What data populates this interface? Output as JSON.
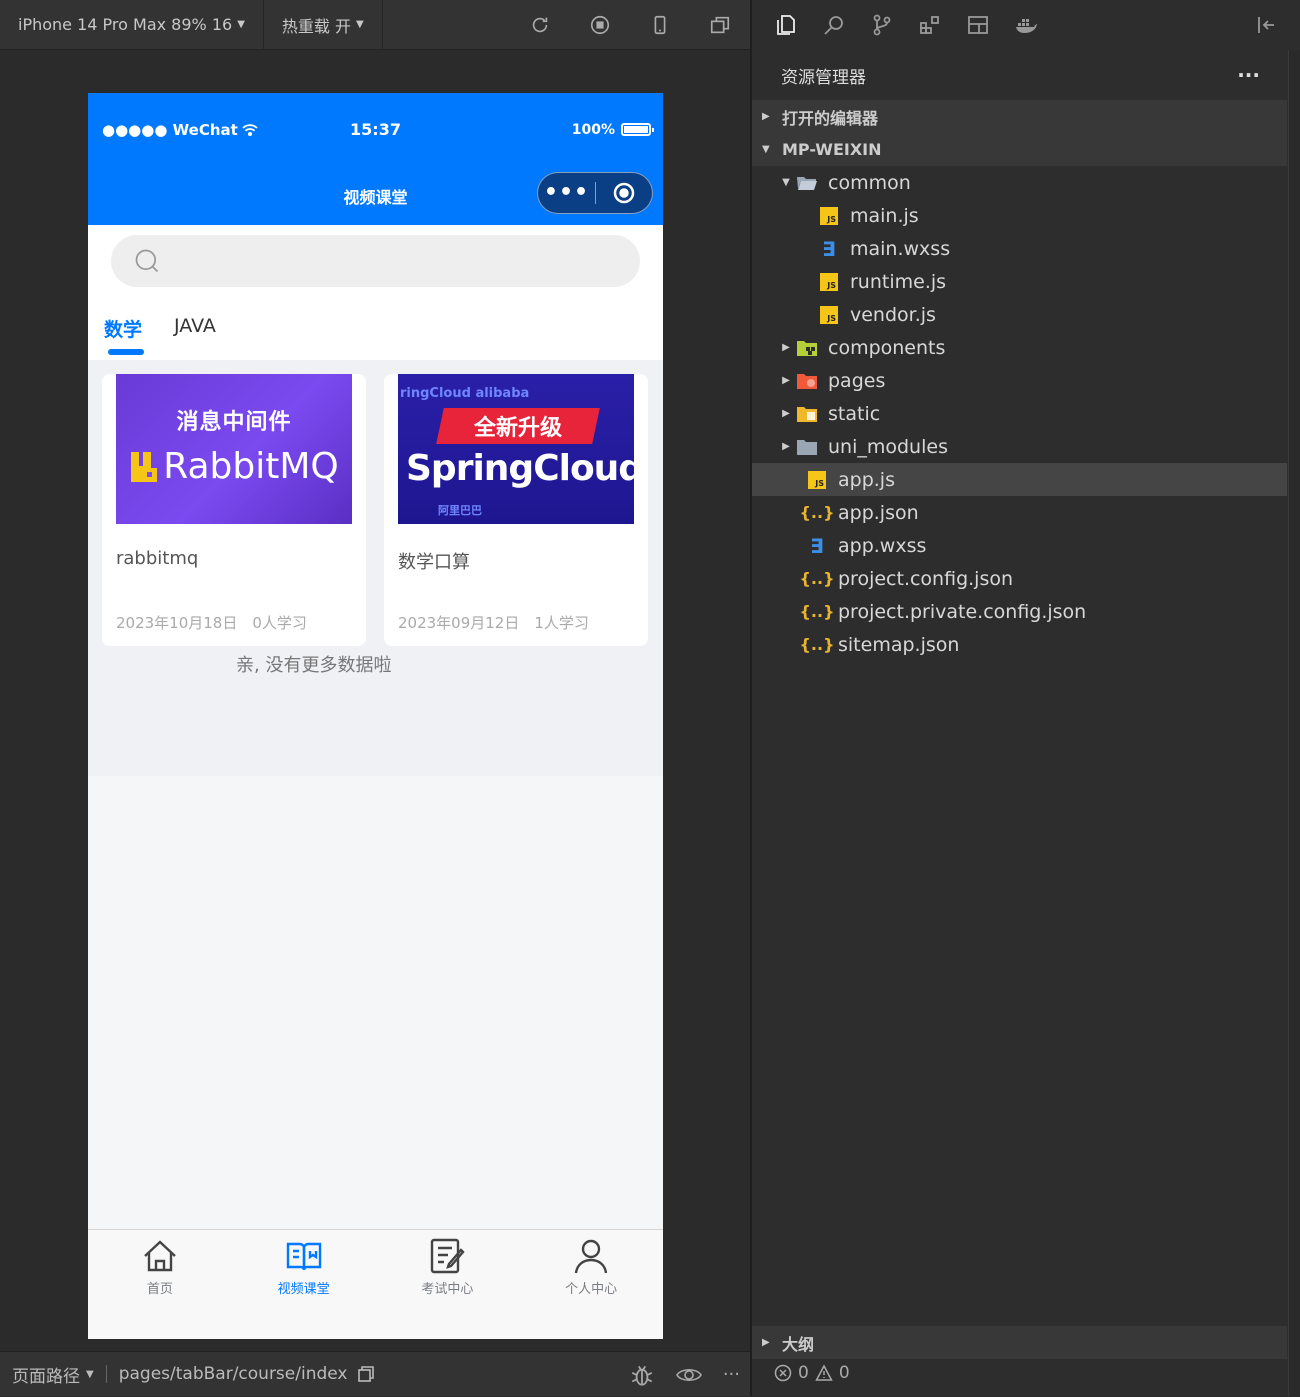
{
  "simulator": {
    "device_label": "iPhone 14 Pro Max 89% 16",
    "hot_reload_label": "热重载 开",
    "footer": {
      "path_label": "页面路径",
      "path_value": "pages/tabBar/course/index"
    }
  },
  "phone": {
    "status": {
      "carrier": "●●●●● WeChat",
      "time": "15:37",
      "battery": "100%"
    },
    "nav_title": "视频课堂",
    "search": {
      "placeholder": ""
    },
    "tabs": [
      {
        "label": "数学",
        "active": true
      },
      {
        "label": "JAVA",
        "active": false
      }
    ],
    "courses": [
      {
        "thumb_title": "消息中间件",
        "thumb_brand": "RabbitMQ",
        "title": "rabbitmq",
        "date": "2023年10月18日",
        "learners": "0人学习"
      },
      {
        "thumb_banner": "全新升级",
        "thumb_brand": "SpringCloud",
        "thumb_top": "ringCloud alibaba",
        "thumb_bottom": "阿里巴巴",
        "title": "数学口算",
        "date": "2023年09月12日",
        "learners": "1人学习"
      }
    ],
    "no_more": "亲, 没有更多数据啦",
    "tabbar": [
      {
        "label": "首页",
        "icon": "home-icon",
        "active": false
      },
      {
        "label": "视频课堂",
        "icon": "book-icon",
        "active": true
      },
      {
        "label": "考试中心",
        "icon": "exam-icon",
        "active": false
      },
      {
        "label": "个人中心",
        "icon": "user-icon",
        "active": false
      }
    ],
    "accent_color": "#0079fe"
  },
  "explorer": {
    "title": "资源管理器",
    "more": "···",
    "open_editors": "打开的编辑器",
    "project": "MP-WEIXIN",
    "tree": [
      {
        "name": "common",
        "type": "folder-open",
        "depth": 1
      },
      {
        "name": "main.js",
        "type": "js",
        "depth": 2
      },
      {
        "name": "main.wxss",
        "type": "css",
        "depth": 2
      },
      {
        "name": "runtime.js",
        "type": "js",
        "depth": 2
      },
      {
        "name": "vendor.js",
        "type": "js",
        "depth": 2
      },
      {
        "name": "components",
        "type": "folder-components",
        "depth": 1
      },
      {
        "name": "pages",
        "type": "folder-pages",
        "depth": 1
      },
      {
        "name": "static",
        "type": "folder-static",
        "depth": 1
      },
      {
        "name": "uni_modules",
        "type": "folder",
        "depth": 1
      },
      {
        "name": "app.js",
        "type": "js",
        "depth": 1,
        "selected": true
      },
      {
        "name": "app.json",
        "type": "json",
        "depth": 1
      },
      {
        "name": "app.wxss",
        "type": "css",
        "depth": 1
      },
      {
        "name": "project.config.json",
        "type": "json",
        "depth": 1
      },
      {
        "name": "project.private.config.json",
        "type": "json",
        "depth": 1
      },
      {
        "name": "sitemap.json",
        "type": "json",
        "depth": 1
      }
    ],
    "outline": "大纲",
    "errors": "0",
    "warnings": "0"
  }
}
